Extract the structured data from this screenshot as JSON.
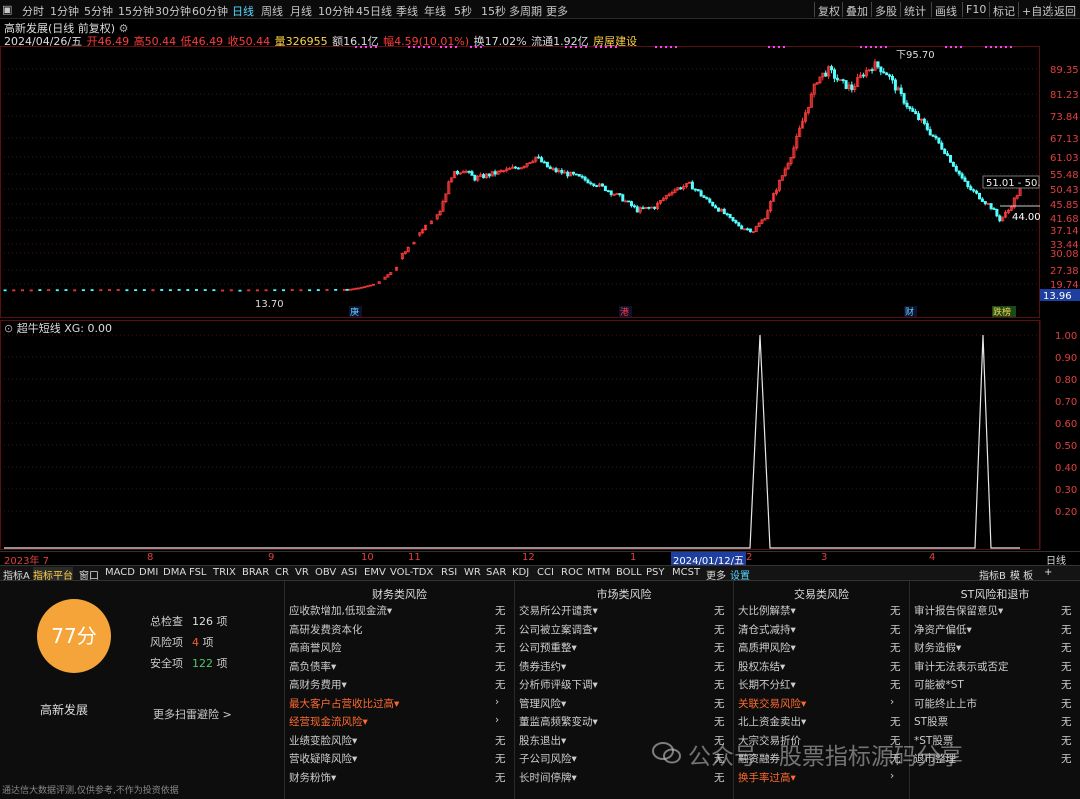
{
  "toolbar": {
    "period_tabs": [
      "分时",
      "1分钟",
      "5分钟",
      "15分钟",
      "30分钟",
      "60分钟",
      "日线",
      "周线",
      "月线",
      "10分钟",
      "45日线",
      "季线",
      "年线",
      "5秒",
      "15秒",
      "多周期",
      "更多"
    ],
    "active_tab": "日线",
    "right_buttons": [
      "复权",
      "叠加",
      "多股",
      "统计",
      "画线",
      "F10",
      "标记",
      "+自选",
      "返回"
    ]
  },
  "stock": {
    "title": "高新发展(日线 前复权)",
    "date": "2024/04/26/五",
    "open": "开46.49",
    "high": "高50.44",
    "low": "低46.49",
    "close": "收50.44",
    "volume": "量326955",
    "amount": "额16.1亿",
    "change": "幅4.59(10.01%)",
    "turnover": "换17.02%",
    "float": "流通1.92亿",
    "tag": "房屋建设"
  },
  "price_axis": {
    "ticks": [
      "89.35",
      "81.23",
      "73.84",
      "67.13",
      "61.03",
      "55.48",
      "50.43",
      "45.85",
      "41.68",
      "37.14",
      "33.44",
      "30.08",
      "27.38",
      "19.74"
    ],
    "current_price": "13.96"
  },
  "annotations": {
    "high_label": "95.70",
    "low_label": "13.70",
    "box_label": "51.01 - 50.",
    "price_marker": "44.00",
    "events": [
      "庚",
      "港",
      "财",
      "跌榜"
    ]
  },
  "indicator": {
    "name": "超牛短线",
    "value_label": "XG: 0.00",
    "ticks": [
      "1.00",
      "0.90",
      "0.80",
      "0.70",
      "0.60",
      "0.50",
      "0.40",
      "0.30",
      "0.20"
    ]
  },
  "time_axis": {
    "labels": [
      "2023年 7",
      "8",
      "9",
      "10",
      "11",
      "12",
      "1",
      "2024/01/12/五",
      "2",
      "3",
      "4"
    ],
    "corner": "日线"
  },
  "indicator_tabs": [
    "指标A",
    "指标平台",
    "窗口",
    "MACD",
    "DMI",
    "DMA",
    "FSL",
    "TRIX",
    "BRAR",
    "CR",
    "VR",
    "OBV",
    "ASI",
    "EMV",
    "VOL-TDX",
    "RSI",
    "WR",
    "SAR",
    "KDJ",
    "CCI",
    "ROC",
    "MTM",
    "BOLL",
    "PSY",
    "MCST",
    "更多",
    "设置"
  ],
  "indicator_tabs_right": [
    "指标B",
    "模 板",
    "+"
  ],
  "risk_panel": {
    "score": "77分",
    "stock_name": "高新发展",
    "stats": [
      {
        "label": "总检查",
        "value": "126",
        "unit": "项",
        "color": "#dddddd"
      },
      {
        "label": "风险项",
        "value": "4",
        "unit": "项",
        "color": "#ff5a2a"
      },
      {
        "label": "安全项",
        "value": "122",
        "unit": "项",
        "color": "#4ec86a"
      }
    ],
    "more_link": "更多扫雷避险 >",
    "disclaimer": "通达信大数据评测,仅供参考,不作为投资依据",
    "columns": [
      {
        "title": "财务类风险",
        "items": [
          {
            "name": "应收款增加,低现金流▾",
            "value": "无",
            "hot": false
          },
          {
            "name": "高研发费资本化",
            "value": "无",
            "hot": false
          },
          {
            "name": "高商誉风险",
            "value": "无",
            "hot": false
          },
          {
            "name": "高负债率▾",
            "value": "无",
            "hot": false
          },
          {
            "name": "高财务费用▾",
            "value": "无",
            "hot": false
          },
          {
            "name": "最大客户占营收比过高▾",
            "value": "›",
            "hot": true
          },
          {
            "name": "经营现金流风险▾",
            "value": "›",
            "hot": true
          },
          {
            "name": "业绩变脸风险▾",
            "value": "无",
            "hot": false
          },
          {
            "name": "营收疑降风险▾",
            "value": "无",
            "hot": false
          },
          {
            "name": "财务粉饰▾",
            "value": "无",
            "hot": false
          }
        ]
      },
      {
        "title": "市场类风险",
        "items": [
          {
            "name": "交易所公开谴责▾",
            "value": "无",
            "hot": false
          },
          {
            "name": "公司被立案调查▾",
            "value": "无",
            "hot": false
          },
          {
            "name": "公司预重整▾",
            "value": "无",
            "hot": false
          },
          {
            "name": "债券违约▾",
            "value": "无",
            "hot": false
          },
          {
            "name": "分析师评级下调▾",
            "value": "无",
            "hot": false
          },
          {
            "name": "管理风险▾",
            "value": "无",
            "hot": false
          },
          {
            "name": "董监高频繁变动▾",
            "value": "无",
            "hot": false
          },
          {
            "name": "股东退出▾",
            "value": "无",
            "hot": false
          },
          {
            "name": "子公司风险▾",
            "value": "无",
            "hot": false
          },
          {
            "name": "长时间停牌▾",
            "value": "无",
            "hot": false
          }
        ]
      },
      {
        "title": "交易类风险",
        "items": [
          {
            "name": "大比例解禁▾",
            "value": "无",
            "hot": false
          },
          {
            "name": "清仓式减持▾",
            "value": "无",
            "hot": false
          },
          {
            "name": "高质押风险▾",
            "value": "无",
            "hot": false
          },
          {
            "name": "股权冻结▾",
            "value": "无",
            "hot": false
          },
          {
            "name": "长期不分红▾",
            "value": "无",
            "hot": false
          },
          {
            "name": "关联交易风险▾",
            "value": "›",
            "hot": true
          },
          {
            "name": "北上资金卖出▾",
            "value": "无",
            "hot": false
          },
          {
            "name": "大宗交易折价",
            "value": "无",
            "hot": false
          },
          {
            "name": "融资融券",
            "value": "无",
            "hot": false
          },
          {
            "name": "换手率过高▾",
            "value": "›",
            "hot": true
          }
        ]
      },
      {
        "title": "ST风险和退市",
        "items": [
          {
            "name": "审计报告保留意见▾",
            "value": "无",
            "hot": false
          },
          {
            "name": "净资产偏低▾",
            "value": "无",
            "hot": false
          },
          {
            "name": "财务造假▾",
            "value": "无",
            "hot": false
          },
          {
            "name": "审计无法表示或否定",
            "value": "无",
            "hot": false
          },
          {
            "name": "可能被*ST",
            "value": "无",
            "hot": false
          },
          {
            "name": "可能终止上市",
            "value": "无",
            "hot": false
          },
          {
            "name": "ST股票",
            "value": "无",
            "hot": false
          },
          {
            "name": "*ST股票",
            "value": "无",
            "hot": false
          },
          {
            "name": "退市整理",
            "value": "无",
            "hot": false
          }
        ]
      }
    ]
  },
  "watermark": "公众号 · 股票指标源码分享",
  "colors": {
    "up": "#ff3b3b",
    "down": "#54ffff",
    "accent": "#ffd24a",
    "signal": "#ff3cff"
  }
}
